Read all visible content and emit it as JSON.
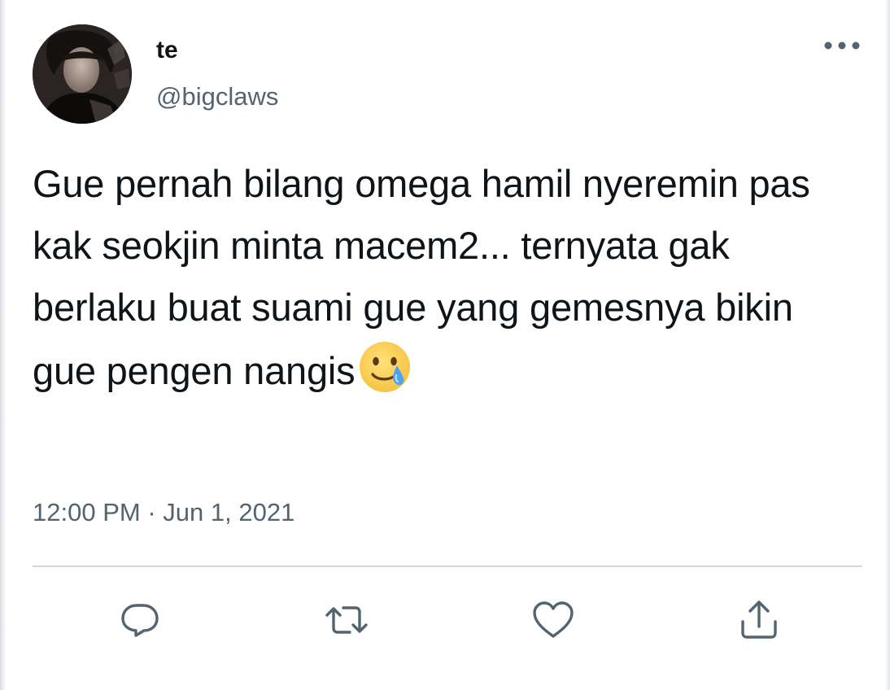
{
  "tweet": {
    "author": {
      "display_name": "te",
      "handle": "@bigclaws",
      "avatar_icon": "profile-photo"
    },
    "text": "Gue pernah bilang omega hamil nyeremin pas kak seokjin minta macem2... ternyata gak berlaku buat suami gue yang gemesnya bikin gue pengen nangis",
    "emoji_icon": "smiling-face-with-tear-icon",
    "time": "12:00 PM",
    "separator": "·",
    "date": "Jun 1, 2021"
  },
  "actions": {
    "reply_icon": "reply-icon",
    "retweet_icon": "retweet-icon",
    "like_icon": "heart-icon",
    "share_icon": "share-icon",
    "more_icon": "more-dots-icon"
  },
  "colors": {
    "text_primary": "#0f1419",
    "text_secondary": "#536471",
    "divider": "#cfd9de",
    "icon": "#536471"
  }
}
